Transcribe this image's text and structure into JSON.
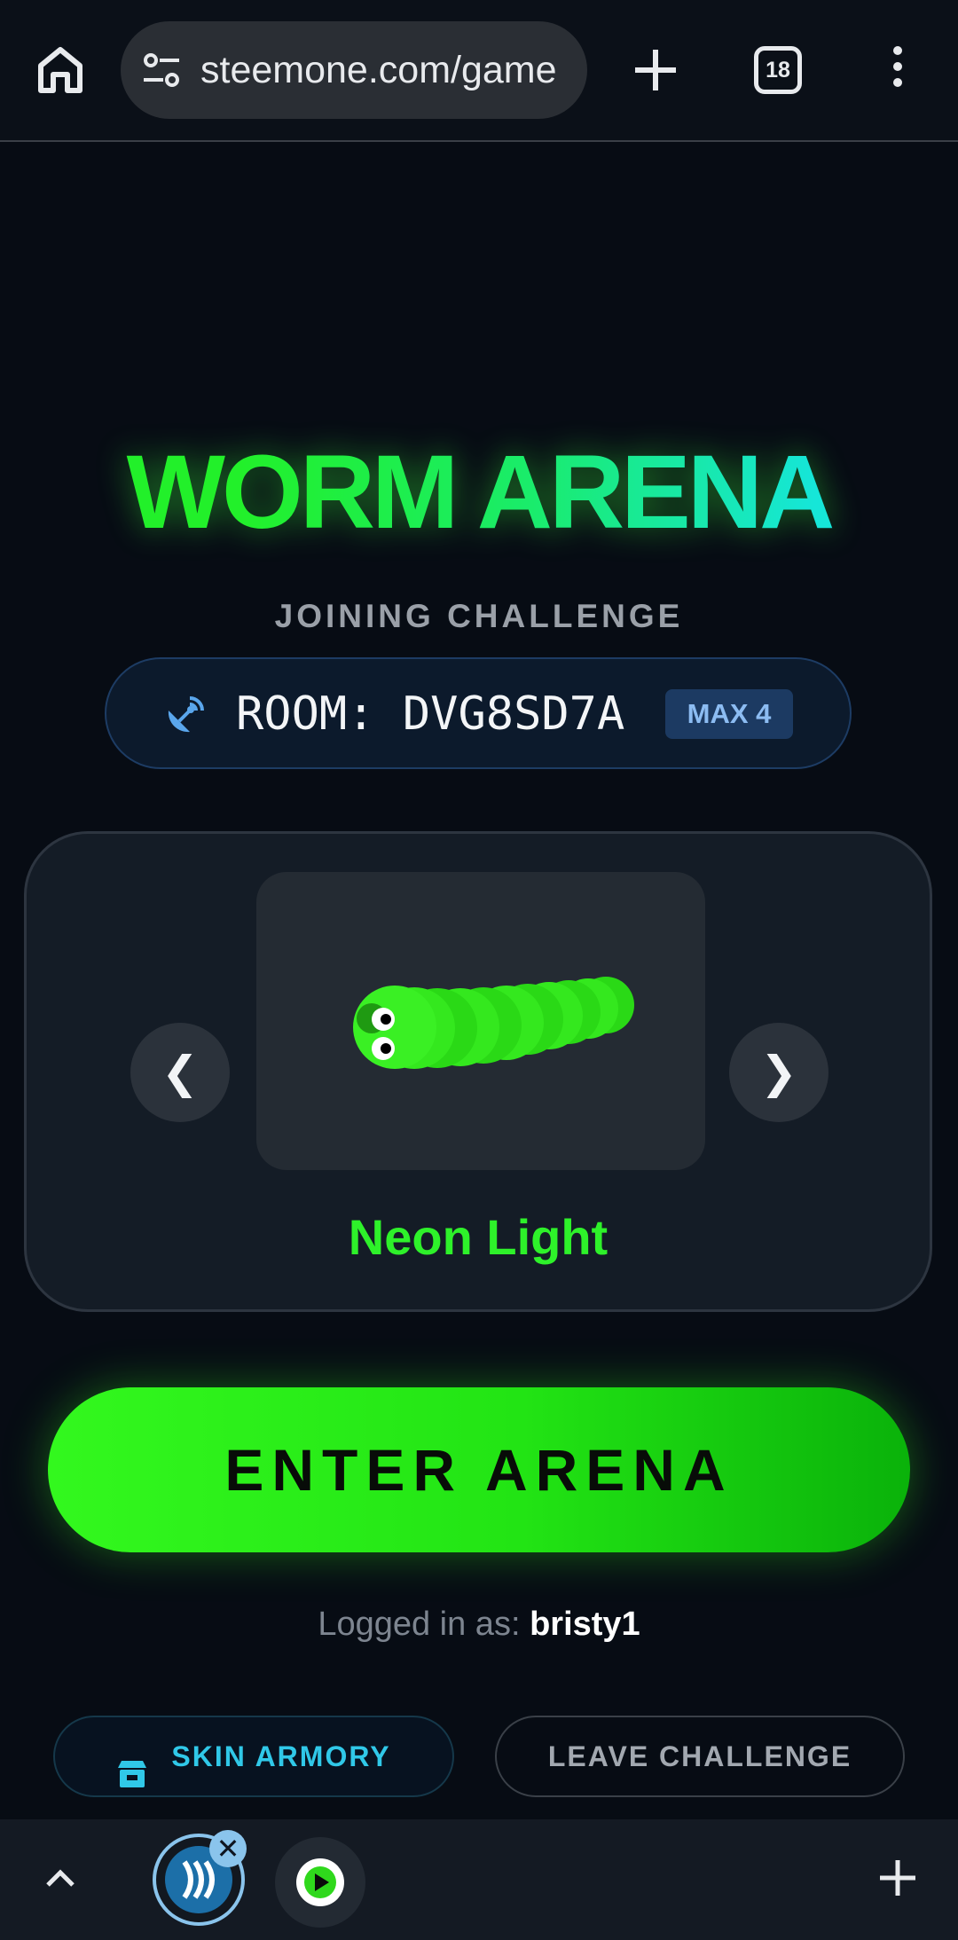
{
  "browser": {
    "url": "steemone.com/game",
    "tab_count": "18",
    "icons": [
      "home-icon",
      "site-info-icon",
      "new-tab-icon",
      "tab-switcher-icon",
      "more-menu-icon"
    ]
  },
  "game": {
    "title": "WORM ARENA",
    "subtitle": "JOINING CHALLENGE",
    "room": {
      "label": "ROOM: DVG8SD7A",
      "max": "MAX 4"
    },
    "skin": {
      "prev": "❮",
      "next": "❯",
      "name": "Neon Light",
      "color": "#2ef12a"
    },
    "enter_label": "ENTER ARENA",
    "logged_in_prefix": "Logged in as:",
    "username": "bristy1",
    "skin_armory_label": "SKIN ARMORY",
    "leave_label": "LEAVE CHALLENGE"
  },
  "bottom_bar": {
    "close_glyph": "✕"
  },
  "colors": {
    "background": "#070c14",
    "accent_green": "#2ef12a",
    "accent_cyan": "#30c8e8",
    "badge_blue": "#1c3a62"
  }
}
